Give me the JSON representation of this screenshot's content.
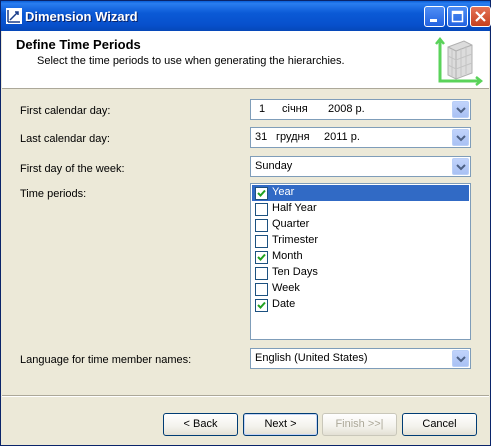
{
  "window": {
    "title": "Dimension Wizard",
    "icon": "wizard-icon"
  },
  "header": {
    "title": "Define Time Periods",
    "subtitle": "Select the time periods to use when generating the hierarchies."
  },
  "form": {
    "first_calendar_day": {
      "label": "First calendar day:",
      "day": "1",
      "month": "січня",
      "year": "2008 р."
    },
    "last_calendar_day": {
      "label": "Last calendar day:",
      "day": "31",
      "month": "грудня",
      "year": "2011 р."
    },
    "first_day_of_week": {
      "label": "First day of the week:",
      "value": "Sunday"
    },
    "time_periods": {
      "label": "Time periods:",
      "items": [
        {
          "label": "Year",
          "checked": true,
          "selected": true
        },
        {
          "label": "Half Year",
          "checked": false,
          "selected": false
        },
        {
          "label": "Quarter",
          "checked": false,
          "selected": false
        },
        {
          "label": "Trimester",
          "checked": false,
          "selected": false
        },
        {
          "label": "Month",
          "checked": true,
          "selected": false
        },
        {
          "label": "Ten Days",
          "checked": false,
          "selected": false
        },
        {
          "label": "Week",
          "checked": false,
          "selected": false
        },
        {
          "label": "Date",
          "checked": true,
          "selected": false
        }
      ]
    },
    "language": {
      "label": "Language for time member names:",
      "value": "English (United States)"
    }
  },
  "buttons": {
    "back": "< Back",
    "next": "Next >",
    "finish": "Finish >>|",
    "cancel": "Cancel"
  },
  "colors": {
    "titlebar": "#0750cc",
    "selection": "#316ac5",
    "check": "#21a121"
  }
}
